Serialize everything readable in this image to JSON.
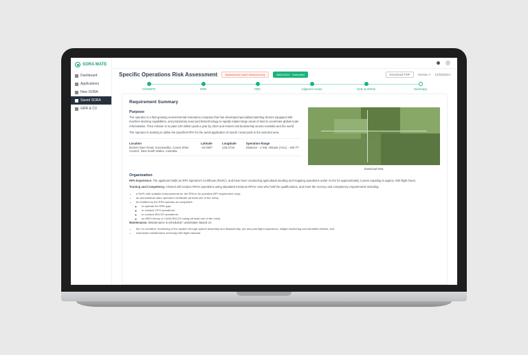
{
  "brand": {
    "name": "SORA MATE"
  },
  "sidebar": {
    "items": [
      {
        "label": "Dashboard",
        "icon": "dashboard-icon"
      },
      {
        "label": "Applications",
        "icon": "apps-icon"
      },
      {
        "label": "New SORA",
        "icon": "plus-icon"
      },
      {
        "label": "Saved SORA",
        "icon": "save-icon",
        "active": true
      },
      {
        "label": "GRR & CV",
        "icon": "doc-icon"
      }
    ]
  },
  "header": {
    "title": "Specific Operations Risk Assessment",
    "badges": {
      "status": "Assessment hadn't finished entry",
      "tag": "485110224 · Submitted"
    },
    "actions": {
      "download": "Download PDF",
      "version": "Version 7",
      "date": "12/03/2024"
    }
  },
  "stepper": [
    {
      "label": "CONOPS",
      "state": "done"
    },
    {
      "label": "GRE",
      "state": "done"
    },
    {
      "label": "ARC",
      "state": "done"
    },
    {
      "label": "Adjacent Areas",
      "state": "done"
    },
    {
      "label": "SAIL & OSOs",
      "state": "done"
    },
    {
      "label": "Summary",
      "state": "current"
    }
  ],
  "summary": {
    "section": "Requirement Summary",
    "purpose_h": "Purpose",
    "purpose_p1": "The operator is a fast-growing environmental restoration company that has developed specialised planting drones equipped with machine learning capabilities, and proprietary seed pod biotechnology to rapidly replant large areas of land to accelerate global-scale reforestation. Their mission is to plant 100 million pods a year by 2024 and restore lost biodiversity across Australia and the world.",
    "purpose_p2": "The operator is seeking to utilise the specified RPA for the aerial application of seeds / seed pods in the selected area.",
    "map_download": "Download KML",
    "meta": {
      "location": {
        "k": "Location",
        "v": "Broken Dam Road, Koorawatha, Cowra Shire Council, New South Wales, Australia"
      },
      "latitude": {
        "k": "Latitude",
        "v": "-34.0087"
      },
      "longitude": {
        "k": "Longitude",
        "v": "148.4719"
      },
      "operation_range": {
        "k": "Operation Range",
        "v": "Distance - 4 KM, Altitude (AGL) - 400 FT"
      }
    },
    "organization_h": "Organization",
    "rpa_experience": {
      "lead": "RPA Experience.",
      "body": "The applicant holds an RPA Operator's Certificate (ReOC), and have been conducting agricultural seeding and mapping operations under VLOS for approximately 3 years equating to approx. 500 flight hours."
    },
    "training": {
      "lead": "Training and Competency.",
      "body": "AirSeed will conduct RPAS operations using stipulated minimum RPAS crew who hold the qualifications, and meet the recency and competency requirements including:",
      "items": [
        "a RePL with suitable endorsements for the RPA to be operated (RP requirement only);",
        "an aeronautical radio operator's certificate (at least one of the crew);",
        "be certified by the RPA operator as competent:"
      ],
      "sub_items": [
        "to operate the RPA type;",
        "to conduct OTH operations;",
        "to conduct BVLOS operations;",
        "an IREX theory or CASA BVLOS rating (at least one of the crew)."
      ]
    },
    "maintenance": {
      "lead": "Maintenance.",
      "body": "Maintenance is scheduled / undertaken based on:",
      "items": [
        "the 'on condition' monitoring of the system through system assembly and disassembly, pre and post flight inspections, inflight monitoring and identified defects; and",
        "scheduled maintenance servicing IAW flight manuals"
      ]
    }
  }
}
